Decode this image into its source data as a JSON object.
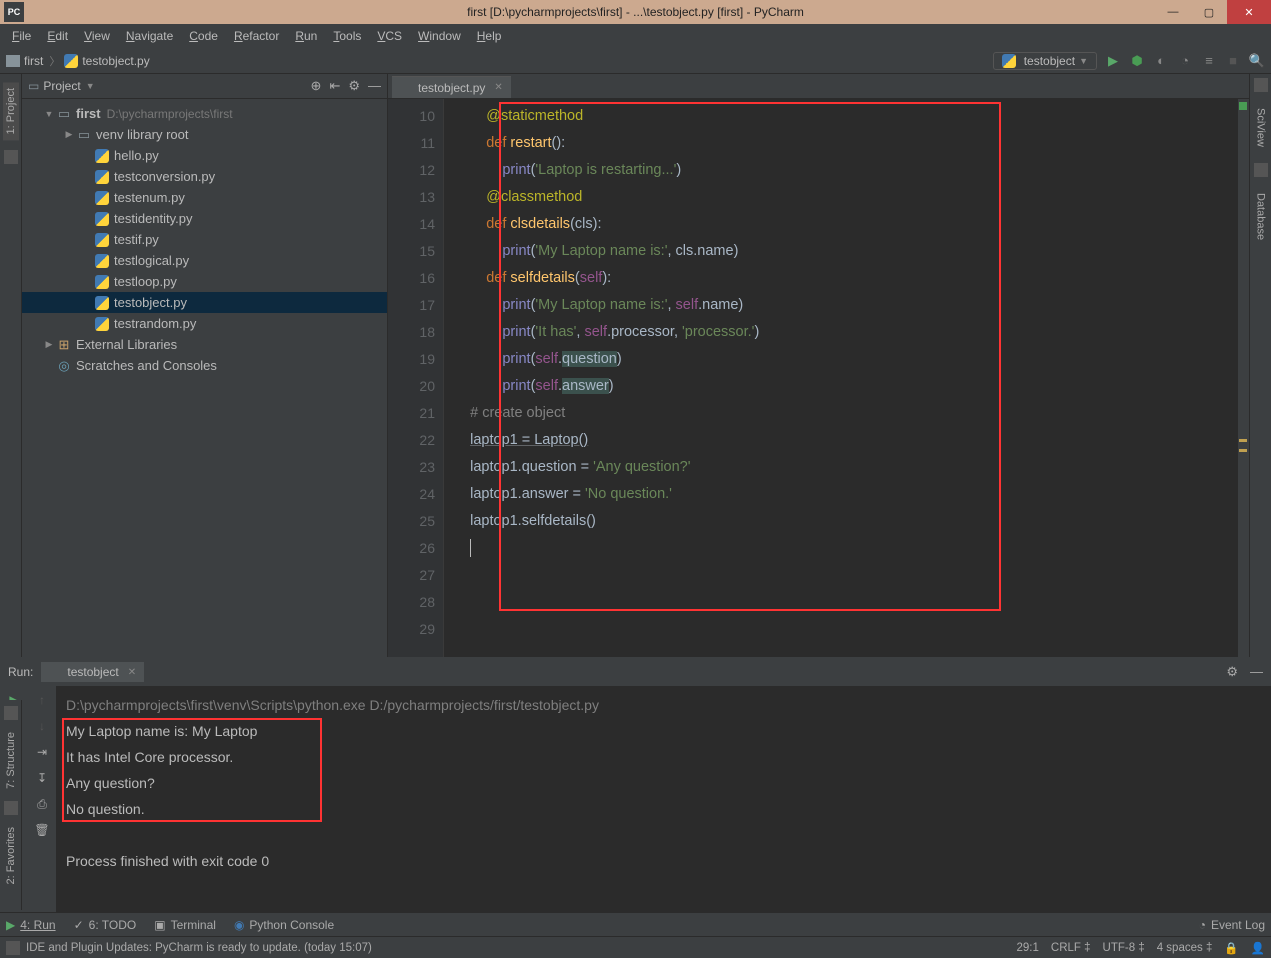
{
  "window": {
    "title": "first [D:\\pycharmprojects\\first] - ...\\testobject.py [first] - PyCharm"
  },
  "menu": [
    "File",
    "Edit",
    "View",
    "Navigate",
    "Code",
    "Refactor",
    "Run",
    "Tools",
    "VCS",
    "Window",
    "Help"
  ],
  "breadcrumb": {
    "project": "first",
    "file": "testobject.py"
  },
  "run_config": "testobject",
  "project_panel": {
    "title": "Project",
    "root": {
      "name": "first",
      "path": "D:\\pycharmprojects\\first"
    },
    "venv": "venv library root",
    "files": [
      "hello.py",
      "testconversion.py",
      "testenum.py",
      "testidentity.py",
      "testif.py",
      "testlogical.py",
      "testloop.py",
      "testobject.py",
      "testrandom.py"
    ],
    "selected": "testobject.py",
    "external": "External Libraries",
    "scratches": "Scratches and Consoles"
  },
  "editor": {
    "tab": "testobject.py",
    "lines": [
      {
        "n": 10,
        "i": 2,
        "t": [
          {
            "c": "decorator",
            "v": "@staticmethod"
          }
        ]
      },
      {
        "n": 11,
        "i": 2,
        "t": [
          {
            "c": "kw",
            "v": "def "
          },
          {
            "c": "fname",
            "v": "restart"
          },
          {
            "c": "",
            "v": "():"
          }
        ]
      },
      {
        "n": 12,
        "i": 3,
        "t": [
          {
            "c": "builtin",
            "v": "print"
          },
          {
            "c": "",
            "v": "("
          },
          {
            "c": "str",
            "v": "'Laptop is restarting...'"
          },
          {
            "c": "",
            "v": ")"
          }
        ]
      },
      {
        "n": 13,
        "i": 0,
        "t": []
      },
      {
        "n": 14,
        "i": 2,
        "t": [
          {
            "c": "decorator",
            "v": "@classmethod"
          }
        ]
      },
      {
        "n": 15,
        "i": 2,
        "t": [
          {
            "c": "kw",
            "v": "def "
          },
          {
            "c": "fname",
            "v": "clsdetails"
          },
          {
            "c": "",
            "v": "("
          },
          {
            "c": "param",
            "v": "cls"
          },
          {
            "c": "",
            "v": "):"
          }
        ]
      },
      {
        "n": 16,
        "i": 3,
        "t": [
          {
            "c": "builtin",
            "v": "print"
          },
          {
            "c": "",
            "v": "("
          },
          {
            "c": "str",
            "v": "'My Laptop name is:'"
          },
          {
            "c": "",
            "v": ", cls.name)"
          }
        ]
      },
      {
        "n": 17,
        "i": 0,
        "t": []
      },
      {
        "n": 18,
        "i": 2,
        "t": [
          {
            "c": "kw",
            "v": "def "
          },
          {
            "c": "fname",
            "v": "selfdetails"
          },
          {
            "c": "",
            "v": "("
          },
          {
            "c": "self",
            "v": "self"
          },
          {
            "c": "",
            "v": "):"
          }
        ]
      },
      {
        "n": 19,
        "i": 3,
        "t": [
          {
            "c": "builtin",
            "v": "print"
          },
          {
            "c": "",
            "v": "("
          },
          {
            "c": "str",
            "v": "'My Laptop name is:'"
          },
          {
            "c": "",
            "v": ", "
          },
          {
            "c": "self",
            "v": "self"
          },
          {
            "c": "",
            "v": ".name)"
          }
        ]
      },
      {
        "n": 20,
        "i": 3,
        "t": [
          {
            "c": "builtin",
            "v": "print"
          },
          {
            "c": "",
            "v": "("
          },
          {
            "c": "str",
            "v": "'It has'"
          },
          {
            "c": "",
            "v": ", "
          },
          {
            "c": "self",
            "v": "self"
          },
          {
            "c": "",
            "v": ".processor, "
          },
          {
            "c": "str",
            "v": "'processor.'"
          },
          {
            "c": "",
            "v": ")"
          }
        ]
      },
      {
        "n": 21,
        "i": 3,
        "t": [
          {
            "c": "builtin",
            "v": "print"
          },
          {
            "c": "",
            "v": "("
          },
          {
            "c": "self",
            "v": "self"
          },
          {
            "c": "",
            "v": "."
          },
          {
            "c": "hl",
            "v": "question"
          },
          {
            "c": "",
            "v": ")"
          }
        ]
      },
      {
        "n": 22,
        "i": 3,
        "t": [
          {
            "c": "builtin",
            "v": "print"
          },
          {
            "c": "",
            "v": "("
          },
          {
            "c": "self",
            "v": "self"
          },
          {
            "c": "",
            "v": "."
          },
          {
            "c": "hl",
            "v": "answer"
          },
          {
            "c": "",
            "v": ")"
          }
        ]
      },
      {
        "n": 23,
        "i": 0,
        "t": []
      },
      {
        "n": 24,
        "i": 1,
        "t": [
          {
            "c": "comment",
            "v": "# create object"
          }
        ]
      },
      {
        "n": 25,
        "i": 1,
        "t": [
          {
            "c": "uline",
            "v": "laptop1 = Laptop()"
          }
        ]
      },
      {
        "n": 26,
        "i": 1,
        "t": [
          {
            "c": "",
            "v": "laptop1.question = "
          },
          {
            "c": "str",
            "v": "'Any question?'"
          }
        ]
      },
      {
        "n": 27,
        "i": 1,
        "t": [
          {
            "c": "",
            "v": "laptop1.answer = "
          },
          {
            "c": "str",
            "v": "'No question.'"
          }
        ]
      },
      {
        "n": 28,
        "i": 1,
        "t": [
          {
            "c": "",
            "v": "laptop1.selfdetails()"
          }
        ]
      },
      {
        "n": 29,
        "i": 1,
        "t": [
          {
            "c": "cursor",
            "v": ""
          }
        ]
      }
    ]
  },
  "run": {
    "label": "Run:",
    "tab": "testobject",
    "cmd": "D:\\pycharmprojects\\first\\venv\\Scripts\\python.exe D:/pycharmprojects/first/testobject.py",
    "out": [
      "My Laptop name is: My Laptop",
      "It has Intel Core processor.",
      "Any question?",
      "No question.",
      "",
      "Process finished with exit code 0"
    ]
  },
  "bottom_tabs": {
    "run": "4: Run",
    "todo": "6: TODO",
    "terminal": "Terminal",
    "pyconsole": "Python Console",
    "eventlog": "Event Log"
  },
  "left_tabs": {
    "project": "1: Project",
    "structure": "7: Structure",
    "favorites": "2: Favorites"
  },
  "right_tabs": {
    "sciview": "SciView",
    "database": "Database"
  },
  "status": {
    "msg": "IDE and Plugin Updates: PyCharm is ready to update. (today 15:07)",
    "pos": "29:1",
    "eol": "CRLF",
    "enc": "UTF-8",
    "indent": "4 spaces"
  }
}
